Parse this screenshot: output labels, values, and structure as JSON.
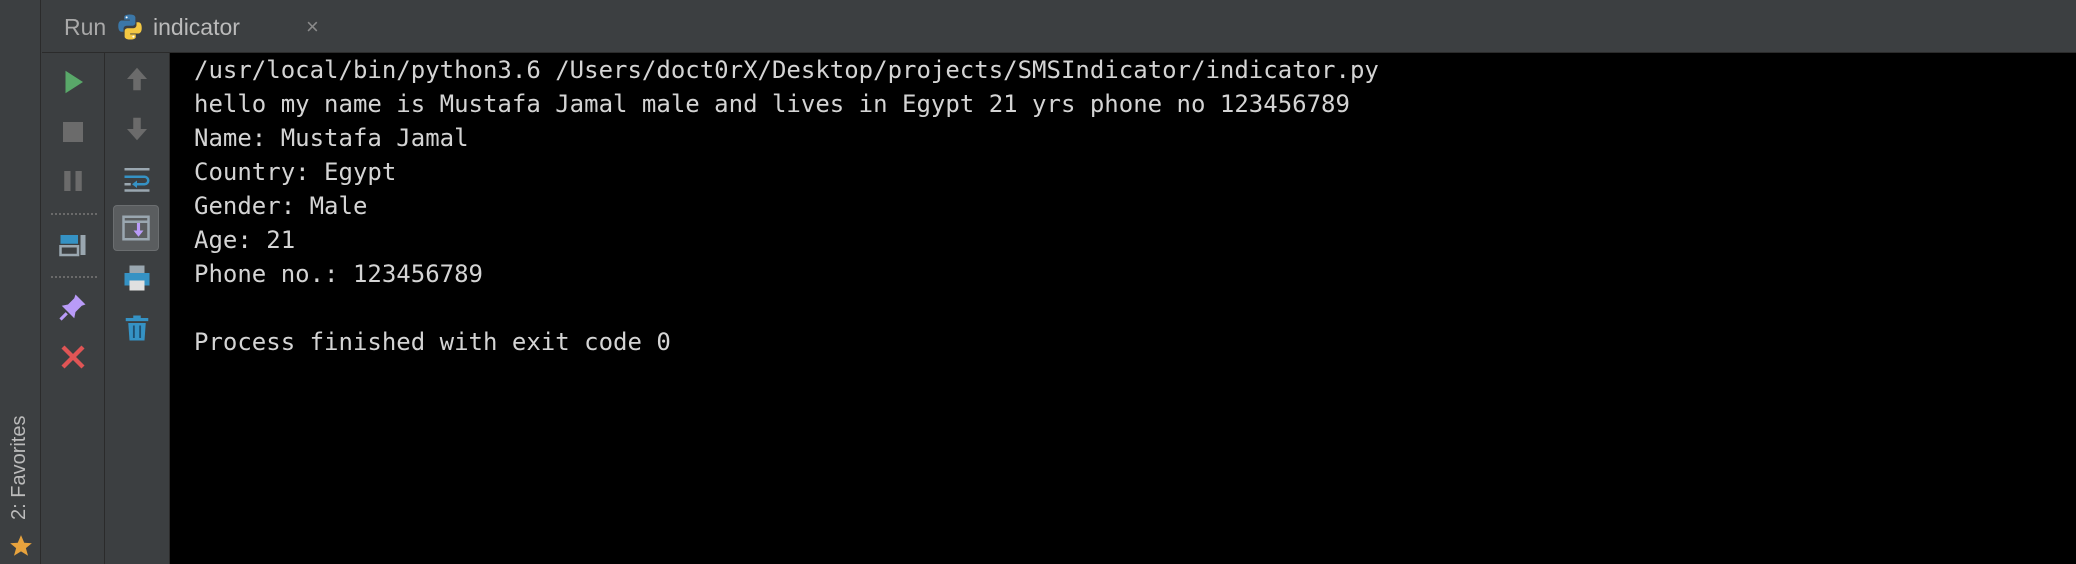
{
  "header": {
    "run_label": "Run",
    "tab_title": "indicator",
    "close_glyph": "×"
  },
  "favorites": {
    "label": "2: Favorites"
  },
  "toolbar_left": [
    {
      "name": "rerun-icon",
      "color": "#59a869"
    },
    {
      "name": "stop-icon",
      "color": "#6b6b6b"
    },
    {
      "name": "pause-icon",
      "color": "#6b6b6b"
    },
    {
      "name": "restore-layout-icon",
      "color": "#3592c4"
    },
    {
      "name": "pin-icon",
      "color": "#b99bf8"
    },
    {
      "name": "close-icon",
      "color": "#e05555"
    }
  ],
  "toolbar_right": [
    {
      "name": "up-arrow-icon",
      "color": "#6b6b6b"
    },
    {
      "name": "down-arrow-icon",
      "color": "#6b6b6b"
    },
    {
      "name": "soft-wrap-icon",
      "color": "#3592c4"
    },
    {
      "name": "scroll-to-end-icon",
      "color": "#b99bf8"
    },
    {
      "name": "print-icon",
      "color": "#3592c4"
    },
    {
      "name": "trash-icon",
      "color": "#3592c4"
    }
  ],
  "console": {
    "lines": [
      "/usr/local/bin/python3.6 /Users/doct0rX/Desktop/projects/SMSIndicator/indicator.py",
      "hello my name is Mustafa Jamal male and lives in Egypt 21 yrs phone no 123456789",
      "Name: Mustafa Jamal",
      "Country: Egypt",
      "Gender: Male",
      "Age: 21",
      "Phone no.: 123456789",
      "",
      "Process finished with exit code 0"
    ]
  }
}
